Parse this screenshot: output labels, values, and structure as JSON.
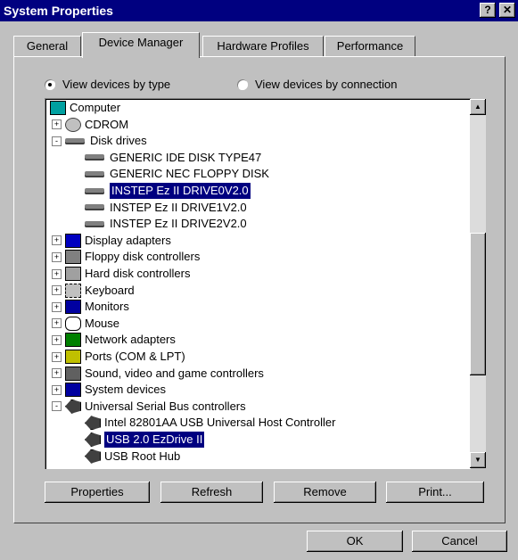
{
  "window": {
    "title": "System Properties",
    "help_label": "?",
    "close_label": "✕"
  },
  "tabs": [
    {
      "label": "General"
    },
    {
      "label": "Device Manager"
    },
    {
      "label": "Hardware Profiles"
    },
    {
      "label": "Performance"
    }
  ],
  "view": {
    "by_type_label": "View devices by type",
    "by_connection_label": "View devices by connection",
    "selected": "by_type"
  },
  "tree": [
    {
      "label": "Computer",
      "level": 0,
      "expander": "",
      "icon": "computer-icon"
    },
    {
      "label": "CDROM",
      "level": 1,
      "expander": "+",
      "icon": "cdrom-icon"
    },
    {
      "label": "Disk drives",
      "level": 1,
      "expander": "-",
      "icon": "disk-drive-icon"
    },
    {
      "label": "GENERIC IDE  DISK TYPE47",
      "level": 2,
      "expander": "",
      "icon": "disk-drive-icon"
    },
    {
      "label": "GENERIC NEC  FLOPPY DISK",
      "level": 2,
      "expander": "",
      "icon": "disk-drive-icon"
    },
    {
      "label": "INSTEP Ez II DRIVE0V2.0",
      "level": 2,
      "expander": "",
      "icon": "disk-drive-icon",
      "selected": true
    },
    {
      "label": "INSTEP Ez II DRIVE1V2.0",
      "level": 2,
      "expander": "",
      "icon": "disk-drive-icon"
    },
    {
      "label": "INSTEP Ez II DRIVE2V2.0",
      "level": 2,
      "expander": "",
      "icon": "disk-drive-icon"
    },
    {
      "label": "Display adapters",
      "level": 1,
      "expander": "+",
      "icon": "display-adapter-icon"
    },
    {
      "label": "Floppy disk controllers",
      "level": 1,
      "expander": "+",
      "icon": "floppy-controller-icon"
    },
    {
      "label": "Hard disk controllers",
      "level": 1,
      "expander": "+",
      "icon": "hard-disk-controller-icon"
    },
    {
      "label": "Keyboard",
      "level": 1,
      "expander": "+",
      "icon": "keyboard-icon"
    },
    {
      "label": "Monitors",
      "level": 1,
      "expander": "+",
      "icon": "monitor-icon"
    },
    {
      "label": "Mouse",
      "level": 1,
      "expander": "+",
      "icon": "mouse-icon"
    },
    {
      "label": "Network adapters",
      "level": 1,
      "expander": "+",
      "icon": "network-adapter-icon"
    },
    {
      "label": "Ports (COM & LPT)",
      "level": 1,
      "expander": "+",
      "icon": "port-icon"
    },
    {
      "label": "Sound, video and game controllers",
      "level": 1,
      "expander": "+",
      "icon": "sound-icon"
    },
    {
      "label": "System devices",
      "level": 1,
      "expander": "+",
      "icon": "system-device-icon"
    },
    {
      "label": "Universal Serial Bus controllers",
      "level": 1,
      "expander": "-",
      "icon": "usb-icon"
    },
    {
      "label": "Intel 82801AA USB Universal Host Controller",
      "level": 2,
      "expander": "",
      "icon": "usb-icon"
    },
    {
      "label": "USB 2.0 EzDrive II",
      "level": 2,
      "expander": "",
      "icon": "usb-icon",
      "selected": true
    },
    {
      "label": "USB Root Hub",
      "level": 2,
      "expander": "",
      "icon": "usb-icon"
    }
  ],
  "actions": {
    "properties_label": "Properties",
    "refresh_label": "Refresh",
    "remove_label": "Remove",
    "print_label": "Print..."
  },
  "dialog": {
    "ok_label": "OK",
    "cancel_label": "Cancel"
  },
  "colors": {
    "titlebar": "#000080",
    "selection": "#000080",
    "face": "#c0c0c0"
  }
}
